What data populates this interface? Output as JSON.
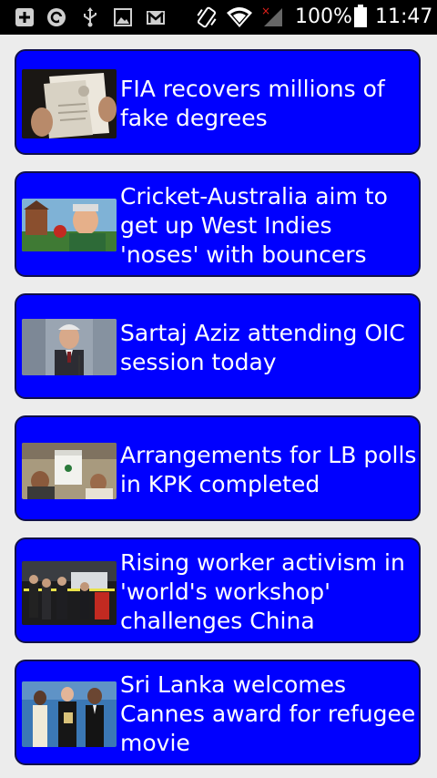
{
  "status_bar": {
    "battery_percent": "100%",
    "time": "11:47",
    "icons": [
      "add-box-icon",
      "sync-circle-icon",
      "usb-icon",
      "image-icon",
      "gmail-icon",
      "vibrate-icon",
      "wifi-icon",
      "signal-icon",
      "battery-icon"
    ]
  },
  "news": {
    "items": [
      {
        "headline": "FIA recovers millions of fake degrees"
      },
      {
        "headline": "Cricket-Australia aim to get up West Indies 'noses' with bouncers"
      },
      {
        "headline": "Sartaj Aziz attending OIC session today"
      },
      {
        "headline": "Arrangements for LB polls in KPK completed"
      },
      {
        "headline": "Rising worker activism in 'world's workshop' challenges China"
      },
      {
        "headline": "Sri Lanka welcomes Cannes award for refugee movie"
      }
    ]
  },
  "colors": {
    "card_bg": "#0000ff",
    "card_border": "#10104a",
    "headline_text": "#ffffff",
    "page_bg": "#ececec",
    "status_bar_bg": "#000000"
  }
}
